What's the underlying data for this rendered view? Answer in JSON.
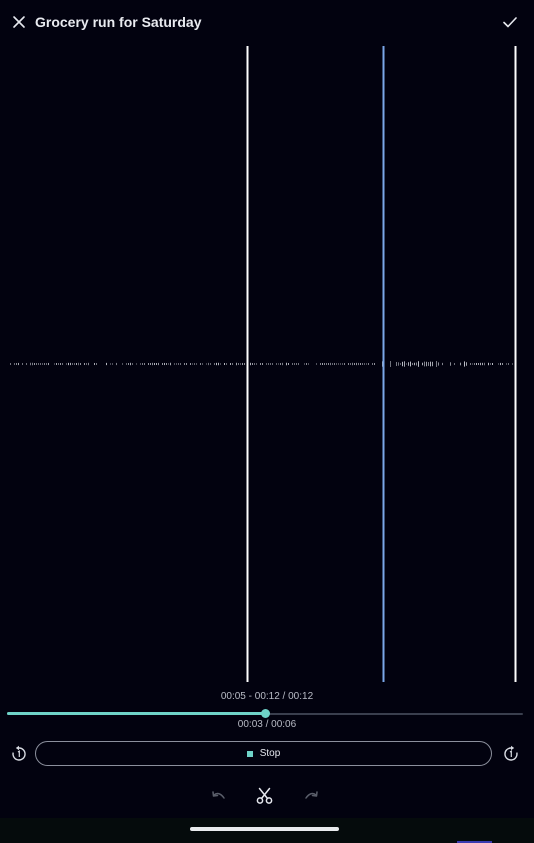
{
  "header": {
    "title": "Grocery run for Saturday",
    "close_icon": "close-icon",
    "confirm_icon": "check-icon"
  },
  "waveform": {
    "colors": {
      "marker": "#ffffff",
      "playhead": "#7aa7e8",
      "wave": "#c9ccd4"
    }
  },
  "trim_info": "00:05 - 00:12 / 00:12",
  "playback": {
    "position_label": "00:03 / 00:06",
    "progress_fraction": 0.5
  },
  "controls": {
    "rewind_icon": "rewind-icon",
    "forward_icon": "fast-forward-icon",
    "stop_label": "Stop",
    "stop_icon": "stop-icon"
  },
  "edit_tools": {
    "undo_icon": "undo-icon",
    "cut_icon": "scissors-icon",
    "redo_icon": "redo-icon"
  },
  "colors": {
    "accent": "#6fd3c8",
    "background": "#02020f"
  }
}
